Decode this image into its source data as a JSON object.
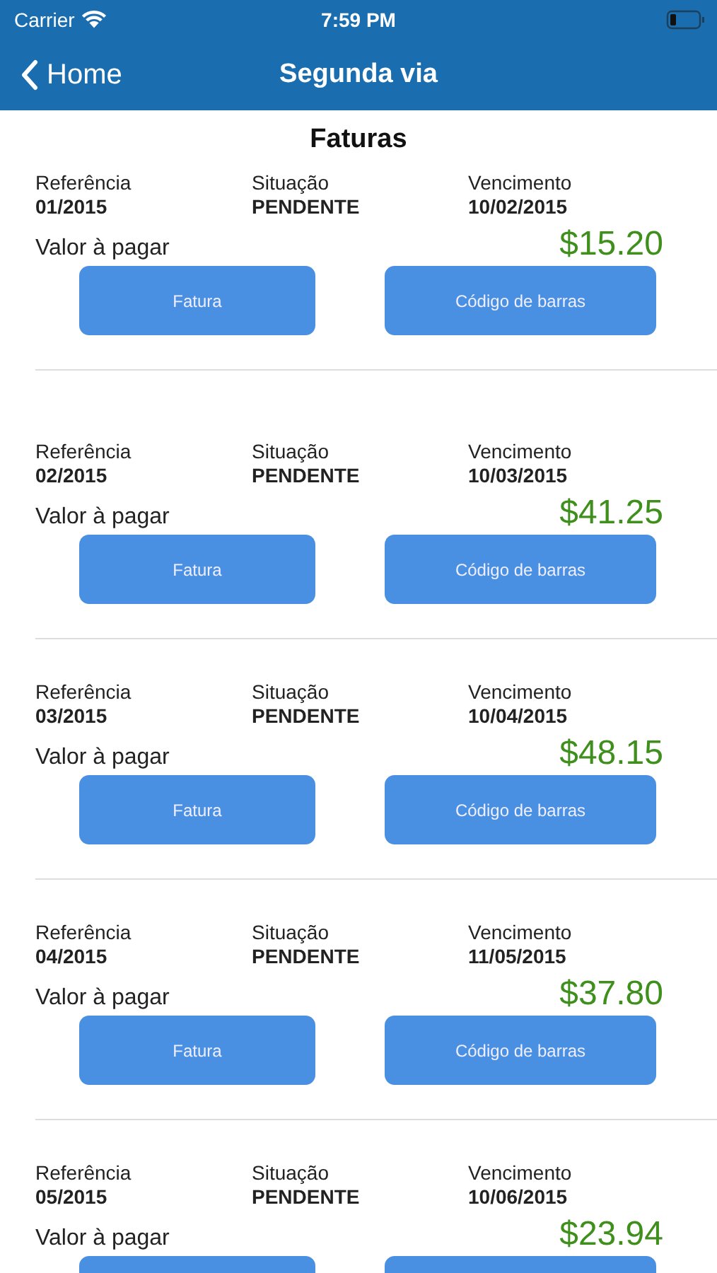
{
  "status_bar": {
    "carrier": "Carrier",
    "time": "7:59 PM"
  },
  "nav": {
    "back": "Home",
    "title": "Segunda via"
  },
  "section_title": "Faturas",
  "invoices": [
    {
      "reference_label": "Referência",
      "reference": "01/2015",
      "status_label": "Situação",
      "status": "PENDENTE",
      "due_label": "Vencimento",
      "due": "10/02/2015",
      "amount_label": "Valor à pagar",
      "amount": "$15.20",
      "buttons": [
        {
          "label": "Fatura"
        },
        {
          "label": "Código de barras"
        }
      ]
    },
    {
      "reference_label": "Referência",
      "reference": "02/2015",
      "status_label": "Situação",
      "status": "PENDENTE",
      "due_label": "Vencimento",
      "due": "10/03/2015",
      "amount_label": "Valor à pagar",
      "amount": "$41.25",
      "buttons": [
        {
          "label": "Fatura"
        },
        {
          "label": "Código de barras"
        }
      ]
    },
    {
      "reference_label": "Referência",
      "reference": "03/2015",
      "status_label": "Situação",
      "status": "PENDENTE",
      "due_label": "Vencimento",
      "due": "10/04/2015",
      "amount_label": "Valor à pagar",
      "amount": "$48.15",
      "buttons": [
        {
          "label": "Fatura"
        },
        {
          "label": "Código de barras"
        }
      ]
    },
    {
      "reference_label": "Referência",
      "reference": "04/2015",
      "status_label": "Situação",
      "status": "PENDENTE",
      "due_label": "Vencimento",
      "due": "11/05/2015",
      "amount_label": "Valor à pagar",
      "amount": "$37.80",
      "buttons": [
        {
          "label": "Fatura"
        },
        {
          "label": "Código de barras"
        }
      ]
    },
    {
      "reference_label": "Referência",
      "reference": "05/2015",
      "status_label": "Situação",
      "status": "PENDENTE",
      "due_label": "Vencimento",
      "due": "10/06/2015",
      "amount_label": "Valor à pagar",
      "amount": "$23.94",
      "buttons": [
        {
          "kind": "cut"
        },
        {
          "kind": "cut"
        }
      ]
    }
  ]
}
